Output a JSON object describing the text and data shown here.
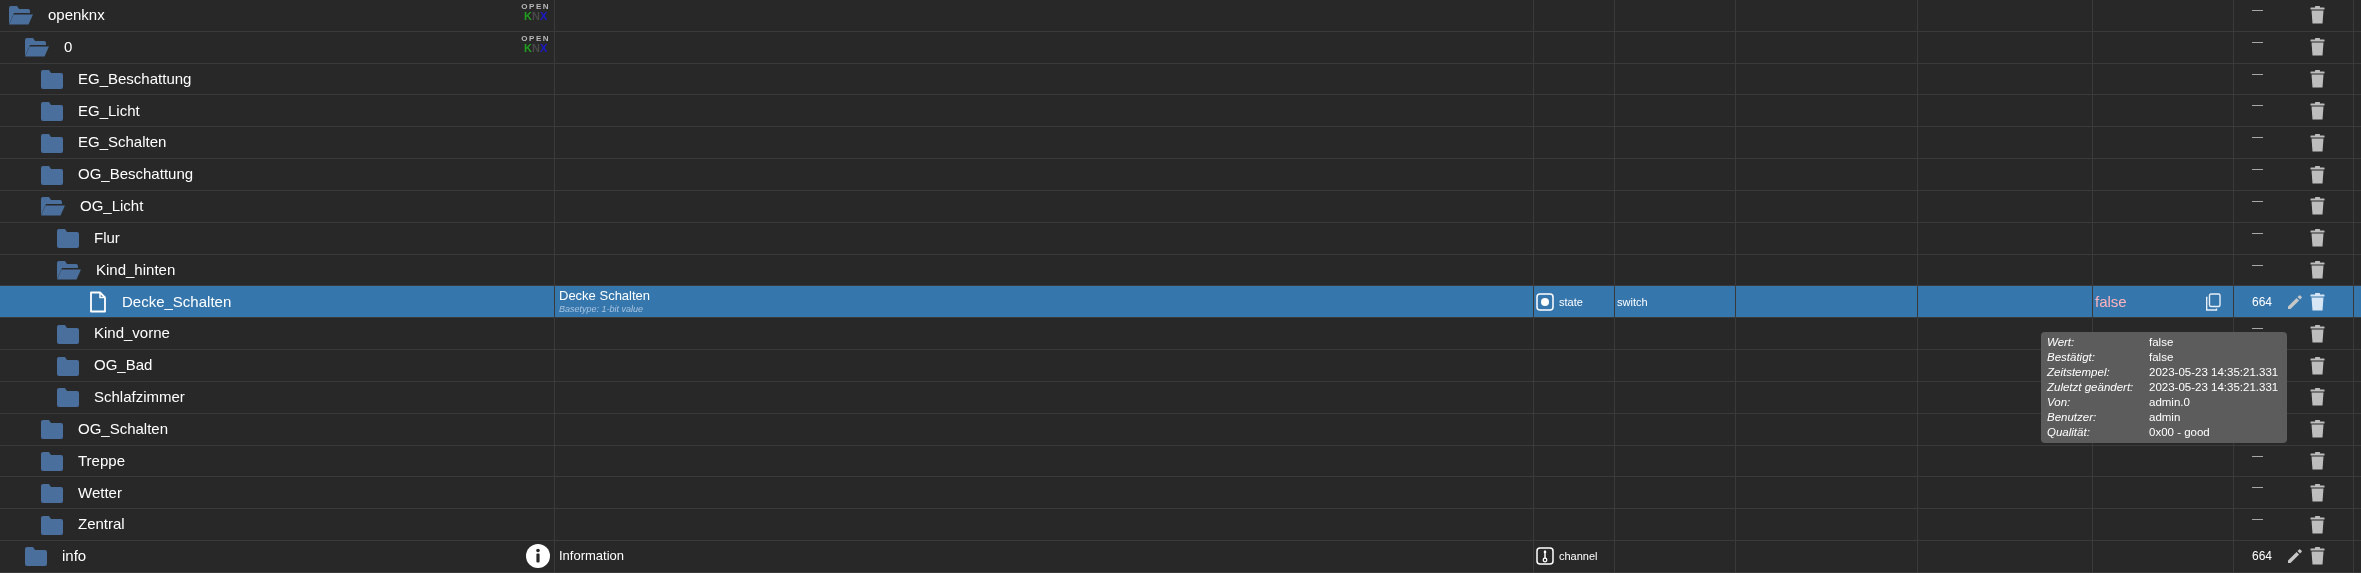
{
  "tree": [
    {
      "name": "openknx",
      "kind": "folder",
      "expanded": true,
      "logo": {
        "top": "OPEN",
        "letters": [
          {
            "text": "K",
            "color": "#1fa01f"
          },
          {
            "text": "N",
            "color": "#4a4a4a"
          },
          {
            "text": "X",
            "color": "#1a1ad0"
          }
        ]
      },
      "action": "—",
      "children": [
        {
          "name": "0",
          "kind": "folder",
          "expanded": true,
          "logo": {
            "top": "OPEN",
            "letters": [
              {
                "text": "K",
                "color": "#1fa01f"
              },
              {
                "text": "N",
                "color": "#4a4a4a"
              },
              {
                "text": "X",
                "color": "#1a1ad0"
              }
            ]
          },
          "action": "—",
          "children": [
            {
              "name": "EG_Beschattung",
              "kind": "folder",
              "expanded": false,
              "action": "—"
            },
            {
              "name": "EG_Licht",
              "kind": "folder",
              "expanded": false,
              "action": "—"
            },
            {
              "name": "EG_Schalten",
              "kind": "folder",
              "expanded": false,
              "action": "—"
            },
            {
              "name": "OG_Beschattung",
              "kind": "folder",
              "expanded": false,
              "action": "—"
            },
            {
              "name": "OG_Licht",
              "kind": "folder",
              "expanded": true,
              "action": "—",
              "children": [
                {
                  "name": "Flur",
                  "kind": "folder",
                  "expanded": false,
                  "action": "—"
                },
                {
                  "name": "Kind_hinten",
                  "kind": "folder",
                  "expanded": true,
                  "action": "—",
                  "children": [
                    {
                      "name": "Decke_Schalten",
                      "kind": "file",
                      "selected": true,
                      "description": "Decke Schalten",
                      "subtitle": "Basetype: 1-bit value",
                      "role": {
                        "kind": "state",
                        "label": "state"
                      },
                      "type": "switch",
                      "value": "false",
                      "copyable": true,
                      "action": "664",
                      "editable": true
                    }
                  ]
                },
                {
                  "name": "Kind_vorne",
                  "kind": "folder",
                  "expanded": false,
                  "action": "—"
                },
                {
                  "name": "OG_Bad",
                  "kind": "folder",
                  "expanded": false
                },
                {
                  "name": "Schlafzimmer",
                  "kind": "folder",
                  "expanded": false
                }
              ]
            },
            {
              "name": "OG_Schalten",
              "kind": "folder",
              "expanded": false
            },
            {
              "name": "Treppe",
              "kind": "folder",
              "expanded": false,
              "action": "—"
            },
            {
              "name": "Wetter",
              "kind": "folder",
              "expanded": false,
              "action": "—"
            },
            {
              "name": "Zentral",
              "kind": "folder",
              "expanded": false,
              "action": "—"
            }
          ]
        },
        {
          "name": "info",
          "kind": "folder",
          "expanded": false,
          "info": true,
          "description": "Information",
          "role": {
            "kind": "channel",
            "label": "channel"
          },
          "action": "664",
          "editable": true
        }
      ]
    }
  ],
  "tooltip": {
    "rows": [
      {
        "label": "Wert:",
        "value": "false"
      },
      {
        "label": "Bestätigt:",
        "value": "false"
      },
      {
        "label": "Zeitstempel:",
        "value": "2023-05-23 14:35:21.331"
      },
      {
        "label": "Zuletzt geändert:",
        "value": "2023-05-23 14:35:21.331"
      },
      {
        "label": "Von:",
        "value": "admin.0"
      },
      {
        "label": "Benutzer:",
        "value": "admin"
      },
      {
        "label": "Qualität:",
        "value": "0x00 - good"
      }
    ]
  }
}
